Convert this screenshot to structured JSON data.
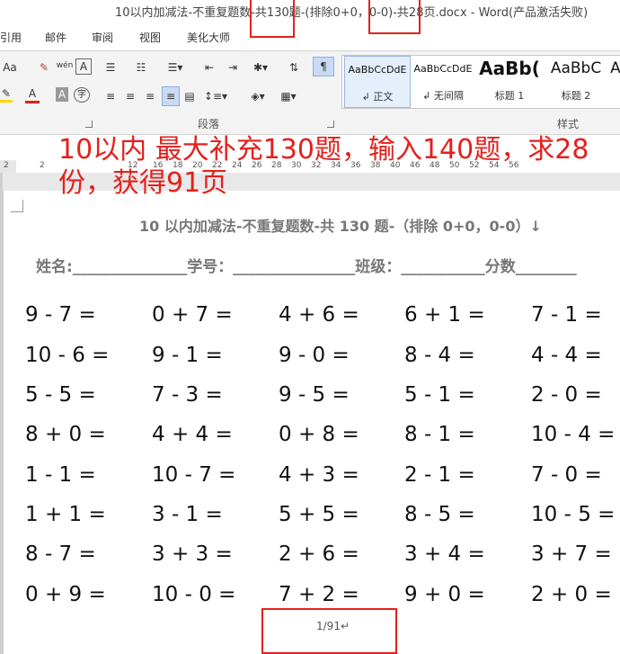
{
  "window": {
    "title": "10以内加减法-不重复题数-共130题-(排除0+0，0-0)-共28页.docx - Word(产品激活失败)"
  },
  "tabs": [
    "引用",
    "邮件",
    "审阅",
    "视图",
    "美化大师"
  ],
  "ribbon": {
    "font_buttons": [
      "Aa",
      "wén",
      "A",
      "A",
      "A",
      "字"
    ],
    "styles": [
      {
        "sample": "AaBbCcDdE",
        "name": "↲ 正文",
        "selected": true
      },
      {
        "sample": "AaBbCcDdE",
        "name": "↲ 无间隔",
        "selected": false
      },
      {
        "sample": "AaBb(",
        "name": "标题 1",
        "selected": false
      },
      {
        "sample": "AaBbC",
        "name": "标题 2",
        "selected": false
      },
      {
        "sample": "A",
        "name": "",
        "selected": false
      }
    ],
    "group_labels": {
      "paragraph": "段落",
      "styles": "样式"
    }
  },
  "ruler_numbers": [
    "2",
    "2",
    "12",
    "16",
    "18",
    "20",
    "22",
    "24",
    "26",
    "28",
    "30",
    "32",
    "34",
    "36",
    "38",
    "40",
    "46",
    "48",
    "50",
    "52",
    "54",
    "56"
  ],
  "annotation": {
    "line1": "10以内 最大补充130题，输入140题，求28",
    "line2": "份，获得91页"
  },
  "document": {
    "title": "10 以内加减法-不重复题数-共 130 题-（排除 0+0，0-0）↓",
    "form": "姓名:_______________学号：________________班级：___________分数________",
    "problems": [
      [
        "9 - 7 =",
        "0 + 7 =",
        "4 + 6 =",
        "6 + 1 =",
        "7 - 1 ="
      ],
      [
        "10 - 6 =",
        "9 - 1 =",
        "9 - 0 =",
        "8 - 4 =",
        "4 - 4 ="
      ],
      [
        "5 - 5 =",
        "7 - 3 =",
        "9 - 5 =",
        "5 - 1 =",
        "2 - 0 ="
      ],
      [
        "8 + 0 =",
        "4 + 4 =",
        "0 + 8 =",
        "8 - 1 =",
        "10 - 4 ="
      ],
      [
        "1 - 1 =",
        "10 - 7 =",
        "4 + 3 =",
        "2 - 1 =",
        "7 - 0 ="
      ],
      [
        "1 + 1 =",
        "3 - 1 =",
        "5 + 5 =",
        "8 - 5 =",
        "10 - 5 ="
      ],
      [
        "8 - 7 =",
        "3 + 3 =",
        "2 + 6 =",
        "3 + 4 =",
        "3 + 7 ="
      ],
      [
        "0 + 9 =",
        "10 - 0 =",
        "7 + 2 =",
        "9 + 0 =",
        "2 + 0 ="
      ]
    ],
    "page_number": "1/91↵"
  },
  "colors": {
    "annotation": "#e4201c",
    "ribbon_bg": "#f3f3f3"
  }
}
